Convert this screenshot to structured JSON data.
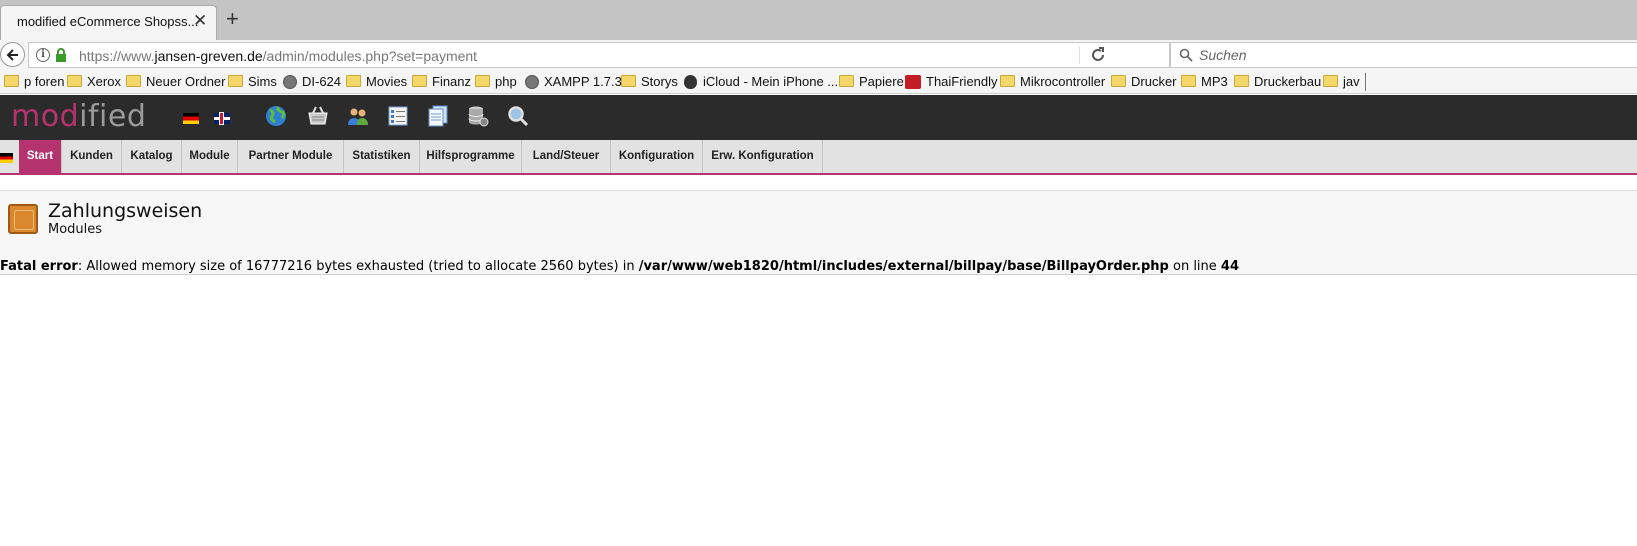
{
  "browser": {
    "tab_title": "modified eCommerce Shopss...",
    "tab_close": "✕",
    "new_tab": "+",
    "url_prefix": "https://www.",
    "url_host": "jansen-greven.de",
    "url_path": "/admin/modules.php?set=payment",
    "search_placeholder": "Suchen"
  },
  "bookmarks": [
    {
      "label": "p foren",
      "icon": "folder-icon"
    },
    {
      "label": "Xerox",
      "icon": "folder-icon"
    },
    {
      "label": "Neuer Ordner",
      "icon": "folder-icon"
    },
    {
      "label": "Sims",
      "icon": "folder-icon"
    },
    {
      "label": "DI-624",
      "icon": "globe-icon"
    },
    {
      "label": "Movies",
      "icon": "folder-icon"
    },
    {
      "label": "Finanz",
      "icon": "folder-icon"
    },
    {
      "label": "php",
      "icon": "folder-icon"
    },
    {
      "label": "XAMPP 1.7.3",
      "icon": "globe-icon"
    },
    {
      "label": "Storys",
      "icon": "folder-icon"
    },
    {
      "label": "iCloud - Mein iPhone ...",
      "icon": "apple-icon"
    },
    {
      "label": "Papiere",
      "icon": "folder-icon"
    },
    {
      "label": "ThaiFriendly",
      "icon": "thaifriendly-icon"
    },
    {
      "label": "Mikrocontroller",
      "icon": "folder-icon"
    },
    {
      "label": "Drucker",
      "icon": "folder-icon"
    },
    {
      "label": "MP3",
      "icon": "folder-icon"
    },
    {
      "label": "Druckerbau",
      "icon": "folder-icon"
    },
    {
      "label": "jav",
      "icon": "folder-icon"
    }
  ],
  "admin": {
    "logo_part1": "mod",
    "logo_part2": "ified",
    "colors": {
      "accent": "#b5336f",
      "header": "#2b2b2b",
      "menu": "#e2e2e2"
    },
    "toolbar_icons": [
      "globe-icon",
      "basket-icon",
      "customers-icon",
      "checklist-icon",
      "documents-icon",
      "database-icon",
      "search-icon"
    ],
    "menu": [
      {
        "label": "Start"
      },
      {
        "label": "Kunden"
      },
      {
        "label": "Katalog"
      },
      {
        "label": "Module"
      },
      {
        "label": "Partner Module"
      },
      {
        "label": "Statistiken"
      },
      {
        "label": "Hilfsprogramme"
      },
      {
        "label": "Land/Steuer"
      },
      {
        "label": "Konfiguration"
      },
      {
        "label": "Erw. Konfiguration"
      }
    ]
  },
  "page": {
    "title": "Zahlungsweisen",
    "subtitle": "Modules",
    "error_label": "Fatal error",
    "error_message": ": Allowed memory size of 16777216 bytes exhausted (tried to allocate 2560 bytes) in ",
    "error_file": "/var/www/web1820/html/includes/external/billpay/base/BillpayOrder.php",
    "error_online": " on line ",
    "error_line": "44"
  }
}
